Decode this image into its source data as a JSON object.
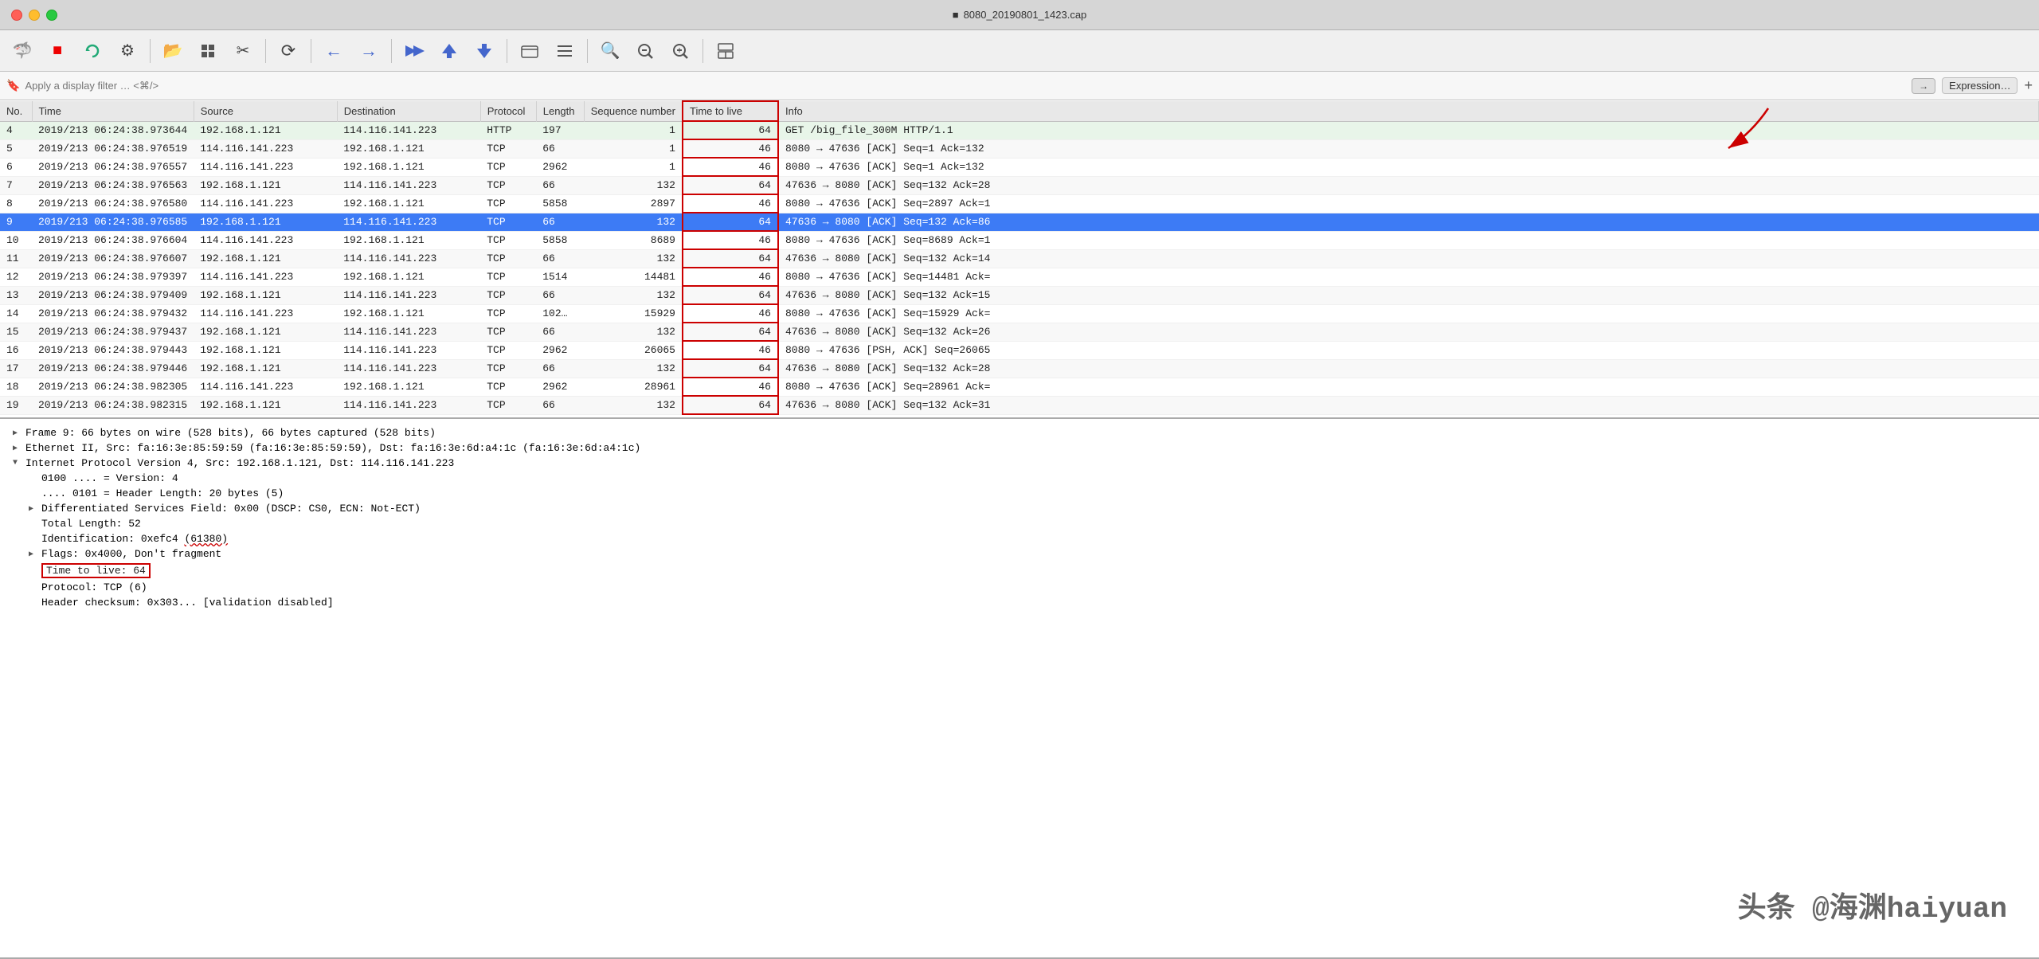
{
  "titlebar": {
    "title": "8080_20190801_1423.cap",
    "icon": "■"
  },
  "toolbar": {
    "buttons": [
      {
        "name": "shark-icon",
        "icon": "🦈",
        "label": "Wireshark"
      },
      {
        "name": "stop-icon",
        "icon": "■",
        "label": "Stop"
      },
      {
        "name": "restart-icon",
        "icon": "↺",
        "label": "Restart"
      },
      {
        "name": "settings-icon",
        "icon": "⚙",
        "label": "Settings"
      },
      {
        "name": "folder-icon",
        "icon": "📂",
        "label": "Open"
      },
      {
        "name": "grid-icon",
        "icon": "⊞",
        "label": "Grid"
      },
      {
        "name": "cut-icon",
        "icon": "✂",
        "label": "Cut"
      },
      {
        "name": "refresh-icon",
        "icon": "⟳",
        "label": "Refresh"
      },
      {
        "name": "back-icon",
        "icon": "←",
        "label": "Back"
      },
      {
        "name": "forward-icon",
        "icon": "→",
        "label": "Forward"
      },
      {
        "name": "go-icon",
        "icon": "⇒",
        "label": "Go"
      },
      {
        "name": "up-icon",
        "icon": "↑",
        "label": "Up"
      },
      {
        "name": "down-icon",
        "icon": "↓",
        "label": "Down"
      },
      {
        "name": "capture1-icon",
        "icon": "▣",
        "label": "Capture"
      },
      {
        "name": "capture2-icon",
        "icon": "≡",
        "label": "Capture2"
      },
      {
        "name": "zoom-in-icon",
        "icon": "⊕",
        "label": "Zoom In"
      },
      {
        "name": "zoom-out-icon",
        "icon": "⊖",
        "label": "Zoom Out"
      },
      {
        "name": "zoom-100-icon",
        "icon": "⊗",
        "label": "Zoom 100"
      },
      {
        "name": "layout-icon",
        "icon": "⊞",
        "label": "Layout"
      }
    ]
  },
  "filterbar": {
    "placeholder": "Apply a display filter … <⌘/>",
    "arrow_label": "→",
    "expression_label": "Expression…",
    "plus_label": "+"
  },
  "packet_list": {
    "columns": [
      "No.",
      "Time",
      "Source",
      "Destination",
      "Protocol",
      "Length",
      "Sequence number",
      "Time to live",
      "Info"
    ],
    "rows": [
      {
        "no": "4",
        "time": "2019/213  06:24:38.973644",
        "source": "192.168.1.121",
        "dest": "114.116.141.223",
        "proto": "HTTP",
        "length": "197",
        "seq": "1",
        "ttl": "64",
        "info": "GET /big_file_300M HTTP/1.1",
        "type": "http"
      },
      {
        "no": "5",
        "time": "2019/213  06:24:38.976519",
        "source": "114.116.141.223",
        "dest": "192.168.1.121",
        "proto": "TCP",
        "length": "66",
        "seq": "1",
        "ttl": "46",
        "info": "8080 → 47636 [ACK] Seq=1 Ack=132",
        "type": "tcp"
      },
      {
        "no": "6",
        "time": "2019/213  06:24:38.976557",
        "source": "114.116.141.223",
        "dest": "192.168.1.121",
        "proto": "TCP",
        "length": "2962",
        "seq": "1",
        "ttl": "46",
        "info": "8080 → 47636 [ACK] Seq=1 Ack=132",
        "type": "tcp"
      },
      {
        "no": "7",
        "time": "2019/213  06:24:38.976563",
        "source": "192.168.1.121",
        "dest": "114.116.141.223",
        "proto": "TCP",
        "length": "66",
        "seq": "132",
        "ttl": "64",
        "info": "47636 → 8080 [ACK] Seq=132 Ack=28",
        "type": "tcp"
      },
      {
        "no": "8",
        "time": "2019/213  06:24:38.976580",
        "source": "114.116.141.223",
        "dest": "192.168.1.121",
        "proto": "TCP",
        "length": "5858",
        "seq": "2897",
        "ttl": "46",
        "info": "8080 → 47636 [ACK] Seq=2897 Ack=1",
        "type": "tcp"
      },
      {
        "no": "9",
        "time": "2019/213  06:24:38.976585",
        "source": "192.168.1.121",
        "dest": "114.116.141.223",
        "proto": "TCP",
        "length": "66",
        "seq": "132",
        "ttl": "64",
        "info": "47636 → 8080 [ACK] Seq=132 Ack=86",
        "type": "tcp-selected"
      },
      {
        "no": "10",
        "time": "2019/213  06:24:38.976604",
        "source": "114.116.141.223",
        "dest": "192.168.1.121",
        "proto": "TCP",
        "length": "5858",
        "seq": "8689",
        "ttl": "46",
        "info": "8080 → 47636 [ACK] Seq=8689 Ack=1",
        "type": "tcp"
      },
      {
        "no": "11",
        "time": "2019/213  06:24:38.976607",
        "source": "192.168.1.121",
        "dest": "114.116.141.223",
        "proto": "TCP",
        "length": "66",
        "seq": "132",
        "ttl": "64",
        "info": "47636 → 8080 [ACK] Seq=132 Ack=14",
        "type": "tcp"
      },
      {
        "no": "12",
        "time": "2019/213  06:24:38.979397",
        "source": "114.116.141.223",
        "dest": "192.168.1.121",
        "proto": "TCP",
        "length": "1514",
        "seq": "14481",
        "ttl": "46",
        "info": "8080 → 47636 [ACK] Seq=14481 Ack=",
        "type": "tcp"
      },
      {
        "no": "13",
        "time": "2019/213  06:24:38.979409",
        "source": "192.168.1.121",
        "dest": "114.116.141.223",
        "proto": "TCP",
        "length": "66",
        "seq": "132",
        "ttl": "64",
        "info": "47636 → 8080 [ACK] Seq=132 Ack=15",
        "type": "tcp"
      },
      {
        "no": "14",
        "time": "2019/213  06:24:38.979432",
        "source": "114.116.141.223",
        "dest": "192.168.1.121",
        "proto": "TCP",
        "length": "102…",
        "seq": "15929",
        "ttl": "46",
        "info": "8080 → 47636 [ACK] Seq=15929 Ack=",
        "type": "tcp"
      },
      {
        "no": "15",
        "time": "2019/213  06:24:38.979437",
        "source": "192.168.1.121",
        "dest": "114.116.141.223",
        "proto": "TCP",
        "length": "66",
        "seq": "132",
        "ttl": "64",
        "info": "47636 → 8080 [ACK] Seq=132 Ack=26",
        "type": "tcp"
      },
      {
        "no": "16",
        "time": "2019/213  06:24:38.979443",
        "source": "192.168.1.121",
        "dest": "114.116.141.223",
        "proto": "TCP",
        "length": "2962",
        "seq": "26065",
        "ttl": "46",
        "info": "8080 → 47636 [PSH, ACK] Seq=26065",
        "type": "tcp"
      },
      {
        "no": "17",
        "time": "2019/213  06:24:38.979446",
        "source": "192.168.1.121",
        "dest": "114.116.141.223",
        "proto": "TCP",
        "length": "66",
        "seq": "132",
        "ttl": "64",
        "info": "47636 → 8080 [ACK] Seq=132 Ack=28",
        "type": "tcp"
      },
      {
        "no": "18",
        "time": "2019/213  06:24:38.982305",
        "source": "114.116.141.223",
        "dest": "192.168.1.121",
        "proto": "TCP",
        "length": "2962",
        "seq": "28961",
        "ttl": "46",
        "info": "8080 → 47636 [ACK] Seq=28961 Ack=",
        "type": "tcp"
      },
      {
        "no": "19",
        "time": "2019/213  06:24:38.982315",
        "source": "192.168.1.121",
        "dest": "114.116.141.223",
        "proto": "TCP",
        "length": "66",
        "seq": "132",
        "ttl": "64",
        "info": "47636 → 8080 [ACK] Seq=132 Ack=31",
        "type": "tcp"
      }
    ]
  },
  "packet_detail": {
    "lines": [
      {
        "indent": 0,
        "expandable": true,
        "expanded": false,
        "text": "Frame 9: 66 bytes on wire (528 bits), 66 bytes captured (528 bits)"
      },
      {
        "indent": 0,
        "expandable": true,
        "expanded": false,
        "text": "Ethernet II, Src: fa:16:3e:85:59:59 (fa:16:3e:85:59:59), Dst: fa:16:3e:6d:a4:1c (fa:16:3e:6d:a4:1c)"
      },
      {
        "indent": 0,
        "expandable": true,
        "expanded": true,
        "text": "Internet Protocol Version 4, Src: 192.168.1.121, Dst: 114.116.141.223"
      },
      {
        "indent": 1,
        "expandable": false,
        "text": "0100 .... = Version: 4"
      },
      {
        "indent": 1,
        "expandable": false,
        "text": ".... 0101 = Header Length: 20 bytes (5)"
      },
      {
        "indent": 1,
        "expandable": true,
        "expanded": false,
        "text": "Differentiated Services Field: 0x00 (DSCP: CS0, ECN: Not-ECT)"
      },
      {
        "indent": 1,
        "expandable": false,
        "text": "Total Length: 52"
      },
      {
        "indent": 1,
        "expandable": false,
        "text": "Identification: 0xefc4 (61380)",
        "annotated": "identification"
      },
      {
        "indent": 1,
        "expandable": true,
        "expanded": false,
        "text": "Flags: 0x4000, Don't fragment",
        "annotated": "flags"
      },
      {
        "indent": 1,
        "expandable": false,
        "text": "Time to live: 64",
        "highlighted": true
      },
      {
        "indent": 1,
        "expandable": false,
        "text": "Protocol: TCP (6)"
      },
      {
        "indent": 1,
        "expandable": false,
        "text": "Header checksum: 0x303... [validation disabled]"
      }
    ]
  },
  "watermark": {
    "text": "头条 @海渊haiyuan"
  },
  "annotations": {
    "ttl_column_highlight": "Time to live column highlighted with red border",
    "ttl_detail_highlight": "Time to live: 64 highlighted with red border",
    "red_arrow": "Arrow pointing from detail to column header"
  }
}
